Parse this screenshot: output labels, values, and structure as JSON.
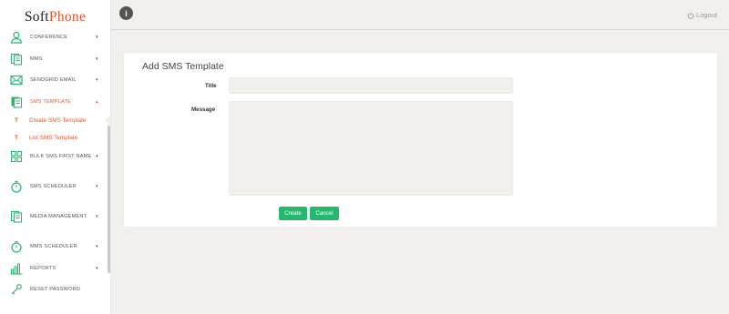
{
  "app": {
    "logo_soft": "Soft",
    "logo_p": "P",
    "logo_hone": "hone"
  },
  "sidebar": {
    "items": [
      {
        "label": "CONFERENCE",
        "icon": "user-icon",
        "caret": "▾"
      },
      {
        "label": "MMS",
        "icon": "document-icon",
        "caret": "▾"
      },
      {
        "label": "SENDGRID EMAIL",
        "icon": "envelope-icon",
        "caret": "▾"
      },
      {
        "label": "SMS TEMPLATE",
        "icon": "template-icon",
        "caret": "▴"
      },
      {
        "label": "BULK SMS FIRST NAME",
        "icon": "grid-icon",
        "caret": "▾"
      },
      {
        "label": "SMS SCHEDULER",
        "icon": "stopwatch-icon",
        "caret": "▾"
      },
      {
        "label": "MEDIA MANAGEMENT",
        "icon": "media-icon",
        "caret": "▾"
      },
      {
        "label": "MMS SCHEDULER",
        "icon": "stopwatch-icon",
        "caret": "▾"
      },
      {
        "label": "REPORTS",
        "icon": "bar-chart-icon",
        "caret": "▾"
      },
      {
        "label": "RESET PASSWORD",
        "icon": "key-icon",
        "caret": ""
      }
    ],
    "sub_items": [
      {
        "prefix": "T",
        "label": "Create SMS Template"
      },
      {
        "prefix": "T",
        "label": "List SMS Template"
      }
    ]
  },
  "topbar": {
    "info_label": "i",
    "logout_label": "Logout"
  },
  "form": {
    "title": "Add SMS Template",
    "title_label": "Title",
    "title_value": "",
    "message_label": "Message",
    "message_value": "",
    "create_label": "Create",
    "cancel_label": "Cancel"
  },
  "colors": {
    "accent": "#e4572e",
    "icon_green": "#26b86e",
    "button_green": "#26b86e",
    "background": "#f1f0ed"
  }
}
